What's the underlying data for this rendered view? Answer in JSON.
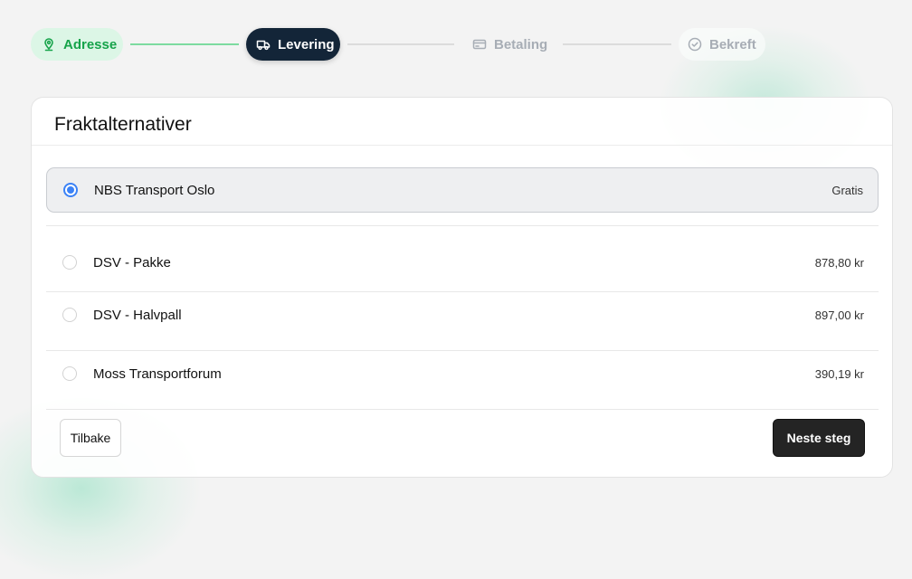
{
  "stepper": {
    "steps": [
      {
        "label": "Adresse",
        "icon": "map-pin-icon",
        "state": "completed"
      },
      {
        "label": "Levering",
        "icon": "truck-icon",
        "state": "active"
      },
      {
        "label": "Betaling",
        "icon": "credit-card-icon",
        "state": "upcoming"
      },
      {
        "label": "Bekreft",
        "icon": "check-circle-icon",
        "state": "upcoming"
      }
    ]
  },
  "shipping": {
    "title": "Fraktalternativer",
    "options": [
      {
        "name": "NBS Transport Oslo",
        "price": "Gratis",
        "selected": true
      },
      {
        "name": "DSV - Pakke",
        "price": "878,80 kr",
        "selected": false
      },
      {
        "name": "DSV - Halvpall",
        "price": "897,00 kr",
        "selected": false
      },
      {
        "name": "Moss Transportforum",
        "price": "390,19 kr",
        "selected": false
      }
    ]
  },
  "actions": {
    "back_label": "Tilbake",
    "next_label": "Neste steg"
  },
  "colors": {
    "accent_green": "#16a34a",
    "active_step_bg": "#132538",
    "radio_selected": "#3b82f6",
    "primary_button": "#242424"
  }
}
